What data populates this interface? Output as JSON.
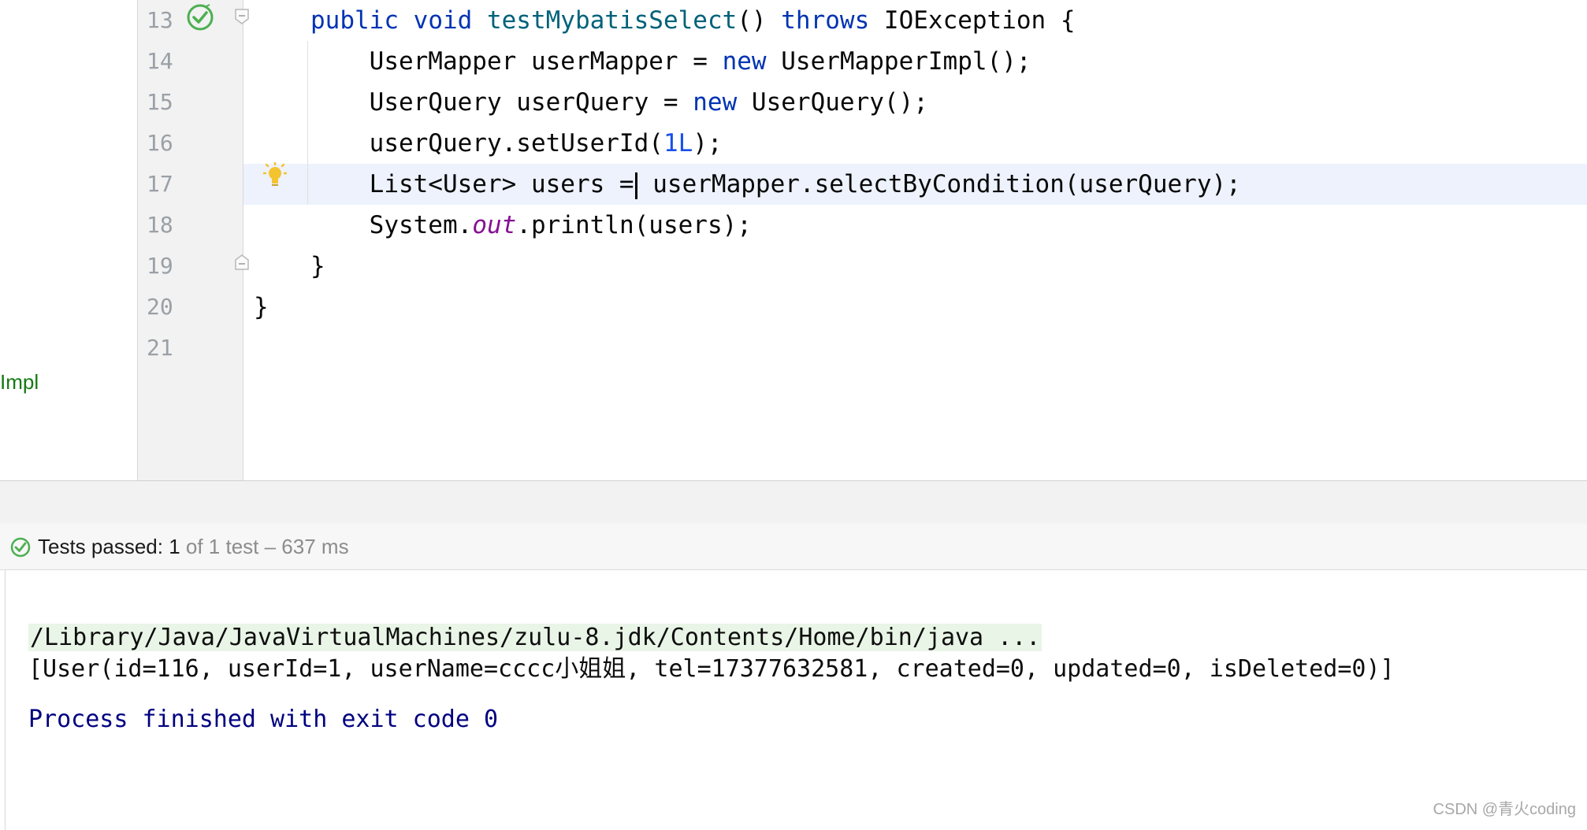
{
  "editor": {
    "impl_label": "Impl",
    "current_line": 17,
    "lines": [
      {
        "num": "13",
        "tokens": [
          [
            "kw",
            "public"
          ],
          [
            "",
            "  "
          ],
          [
            "kw",
            "void"
          ],
          [
            "",
            " "
          ],
          [
            "fn",
            "testMybatisSelect"
          ],
          [
            "",
            "() "
          ],
          [
            "kw",
            "throws"
          ],
          [
            "",
            " IOException {"
          ]
        ]
      },
      {
        "num": "14",
        "tokens": [
          [
            "",
            "    UserMapper userMapper = "
          ],
          [
            "kw",
            "new"
          ],
          [
            "",
            " UserMapperImpl();"
          ]
        ]
      },
      {
        "num": "15",
        "tokens": [
          [
            "",
            "    UserQuery userQuery = "
          ],
          [
            "kw",
            "new"
          ],
          [
            "",
            " UserQuery();"
          ]
        ]
      },
      {
        "num": "16",
        "tokens": [
          [
            "",
            "    userQuery.setUserId("
          ],
          [
            "num",
            "1L"
          ],
          [
            "",
            ");"
          ]
        ]
      },
      {
        "num": "17",
        "tokens": [
          [
            "",
            "    List<User> users ="
          ],
          [
            "caret",
            ""
          ],
          [
            "",
            " userMapper.selectByCondition(userQuery);"
          ]
        ]
      },
      {
        "num": "18",
        "tokens": [
          [
            "",
            "    System."
          ],
          [
            "field",
            "out"
          ],
          [
            "",
            ".println(users);"
          ]
        ]
      },
      {
        "num": "19",
        "tokens": [
          [
            "",
            "}"
          ]
        ]
      },
      {
        "num": "20",
        "tokens": [
          [
            "",
            "}"
          ]
        ]
      },
      {
        "num": "21",
        "tokens": []
      }
    ]
  },
  "test_status": {
    "label": "Tests passed: ",
    "passed": "1",
    "rest": " of 1 test – 637 ms"
  },
  "console": {
    "command": "/Library/Java/JavaVirtualMachines/zulu-8.jdk/Contents/Home/bin/java ...",
    "output": "[User(id=116, userId=1, userName=cccc小姐姐, tel=17377632581, created=0, updated=0, isDeleted=0)]",
    "exit": "Process finished with exit code 0"
  },
  "watermark": "CSDN @青火coding",
  "colors": {
    "keyword": "#0033b3",
    "method": "#00627a",
    "number": "#1750eb",
    "static_field": "#871094",
    "success_green": "#4caf50",
    "exit_text": "#000080"
  },
  "icons": {
    "run": "run-passed-check-icon",
    "fold": "fold-marker-icon",
    "bulb": "intention-bulb-icon",
    "test_ok": "test-passed-check-icon"
  }
}
